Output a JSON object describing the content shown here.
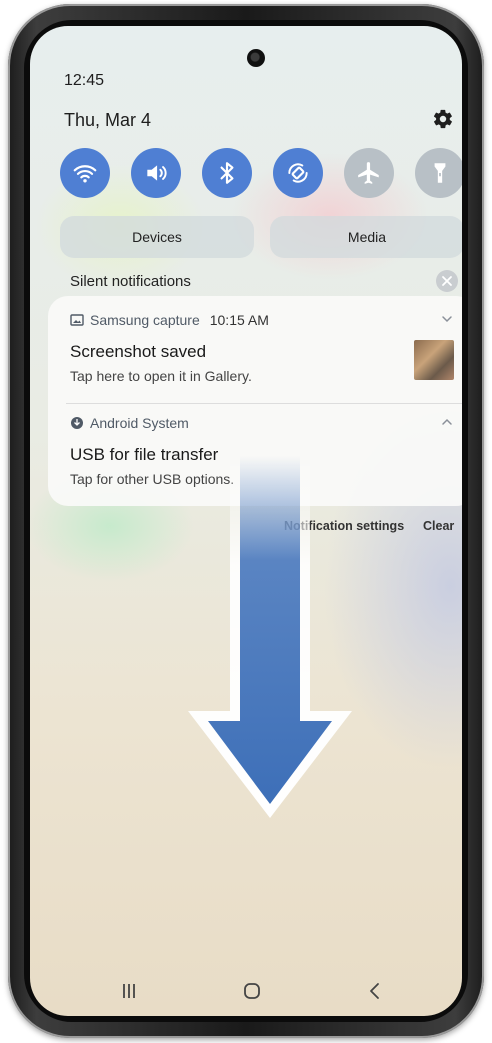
{
  "status_bar": {
    "time": "12:45"
  },
  "panel": {
    "date": "Thu, Mar 4",
    "settings_icon": "gear-icon",
    "quick_settings": [
      {
        "name": "wifi",
        "icon": "wifi-icon",
        "state": "on"
      },
      {
        "name": "sound",
        "icon": "volume-icon",
        "state": "on"
      },
      {
        "name": "bluetooth",
        "icon": "bluetooth-icon",
        "state": "on"
      },
      {
        "name": "auto-rotate",
        "icon": "auto-rotate-icon",
        "state": "on"
      },
      {
        "name": "airplane",
        "icon": "airplane-icon",
        "state": "off"
      },
      {
        "name": "flashlight",
        "icon": "flashlight-icon",
        "state": "off"
      }
    ],
    "devices_label": "Devices",
    "media_label": "Media"
  },
  "silent": {
    "title": "Silent notifications",
    "notifications": [
      {
        "app": "Samsung capture",
        "time": "10:15 AM",
        "title": "Screenshot saved",
        "body": "Tap here to open it in Gallery.",
        "icon": "image-icon",
        "expanded": false
      },
      {
        "app": "Android System",
        "time": "",
        "title": "USB for file transfer",
        "body": "Tap for other USB options.",
        "icon": "android-system-icon",
        "expanded": true
      }
    ]
  },
  "footer": {
    "settings_label": "Notification settings",
    "clear_label": "Clear"
  },
  "nav": {
    "recents": "recents-icon",
    "home": "home-icon",
    "back": "back-icon"
  },
  "colors": {
    "toggle_on": "#4f7fd3",
    "toggle_off": "#b8c0c6",
    "arrow": "#3d6fb8"
  }
}
